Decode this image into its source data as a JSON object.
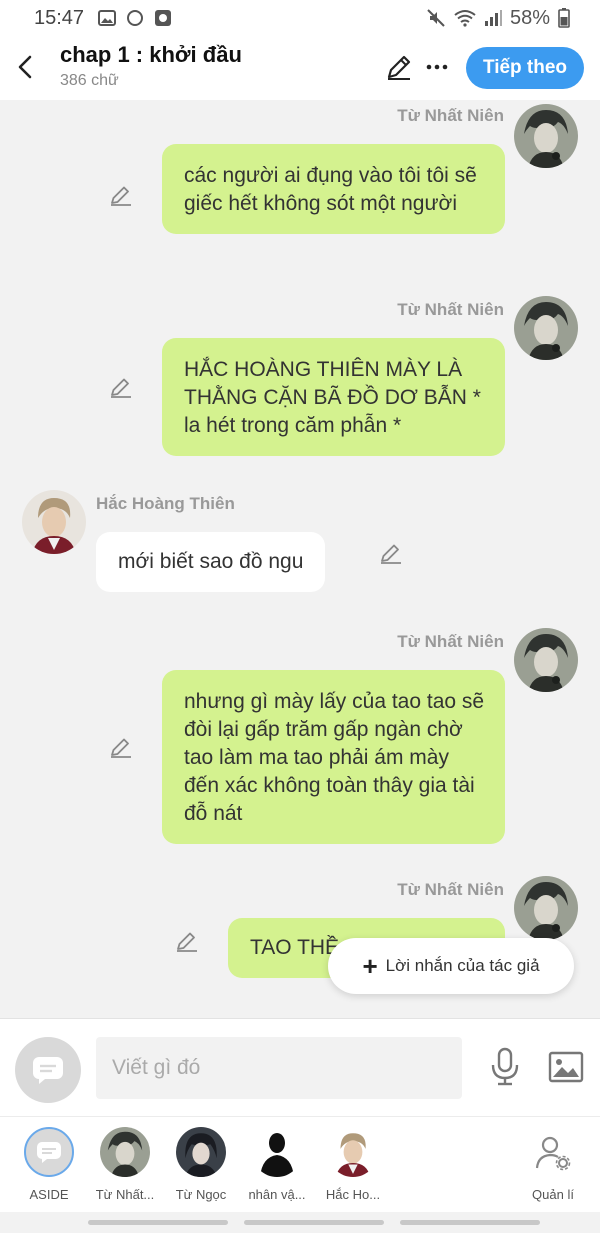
{
  "status_bar": {
    "time": "15:47",
    "battery": "58%"
  },
  "header": {
    "title": "chap 1 : khởi đầu",
    "word_count": "386 chữ",
    "next_label": "Tiếp theo"
  },
  "messages": [
    {
      "side": "right",
      "speaker": "Từ Nhất Niên",
      "text": "các người ai đụng vào tôi tôi sẽ giếc hết không sót một người"
    },
    {
      "side": "right",
      "speaker": "Từ Nhất Niên",
      "text": "HẮC HOÀNG THIÊN MÀY LÀ THẰNG CẶN BÃ ĐỒ DƠ BẪN * la hét trong căm phẫn *"
    },
    {
      "side": "left",
      "speaker": "Hắc Hoàng Thiên",
      "text": "mới biết sao đồ ngu"
    },
    {
      "side": "right",
      "speaker": "Từ Nhất Niên",
      "text": "nhưng gì mày lấy của tao tao sẽ đòi lại gấp trăm gấp ngàn chờ tao làm ma tao phải ám mày đến xác không toàn thây gia tài đỗ nát"
    },
    {
      "side": "right",
      "speaker": "Từ Nhất Niên",
      "text": "TAO THỀ"
    }
  ],
  "author_note_label": "Lời nhắn của tác giả",
  "input": {
    "placeholder": "Viết gì đó"
  },
  "characters": [
    {
      "label": "ASIDE"
    },
    {
      "label": "Từ Nhất..."
    },
    {
      "label": "Từ Ngọc"
    },
    {
      "label": "nhân vậ..."
    },
    {
      "label": "Hắc Ho..."
    }
  ],
  "manage_label": "Quản lí",
  "colors": {
    "accent": "#3c9bf0",
    "bubble_right": "#d4f28f",
    "bubble_left": "#ffffff",
    "background": "#f2f2f2"
  }
}
